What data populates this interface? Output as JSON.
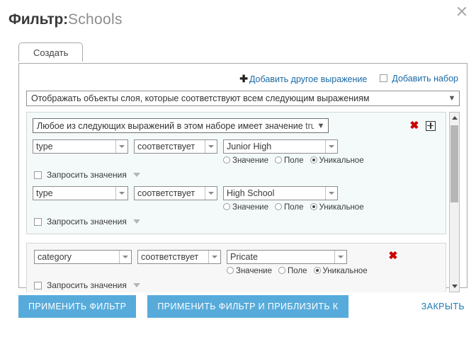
{
  "window": {
    "close_icon": "close-icon"
  },
  "header": {
    "title_label": "Фильтр:",
    "title_value": "Schools"
  },
  "tabs": [
    {
      "label": "Создать",
      "active": true
    }
  ],
  "panel": {
    "add_expression_link": "Добавить другое выражение",
    "add_expression_plus": "✚",
    "add_set_label": "Добавить набор",
    "add_set_checked": false,
    "main_select": {
      "value": "Отображать объекты слоя, которые соответствуют всем следующим выражениям"
    }
  },
  "radio_labels": {
    "value": "Значение",
    "field": "Поле",
    "unique": "Уникальное"
  },
  "ask_values_label": "Запросить значения",
  "expression_set": {
    "header_select": "Любое из следующих выражений в этом наборе имеет значение",
    "header_select_suffix": "true",
    "delete_icon": "delete-icon",
    "add_icon": "add-icon",
    "rows": [
      {
        "field": "type",
        "operator": "соответствует",
        "value": "Junior High",
        "selected_source": "unique",
        "ask_values_checked": false
      },
      {
        "field": "type",
        "operator": "соответствует",
        "value": "High School",
        "selected_source": "unique",
        "ask_values_checked": false
      }
    ]
  },
  "standalone_expression": {
    "field": "category",
    "operator": "соответствует",
    "value": "Pricate",
    "selected_source": "unique",
    "ask_values_checked": false,
    "delete_icon": "delete-icon"
  },
  "scrollbar": {
    "up_icon": "scroll-up-icon",
    "down_icon": "scroll-down-icon"
  },
  "footer": {
    "apply_filter": "ПРИМЕНИТЬ ФИЛЬТР",
    "apply_filter_zoom": "ПРИМЕНИТЬ ФИЛЬТР И ПРИБЛИЗИТЬ К",
    "close": "ЗАКРЫТЬ"
  },
  "colors": {
    "accent_blue": "#57abdb",
    "link_blue": "#1b6aa5",
    "delete_red": "#cc0000",
    "set_background": "#f4fafa",
    "plain_background": "#f7f7f7"
  }
}
